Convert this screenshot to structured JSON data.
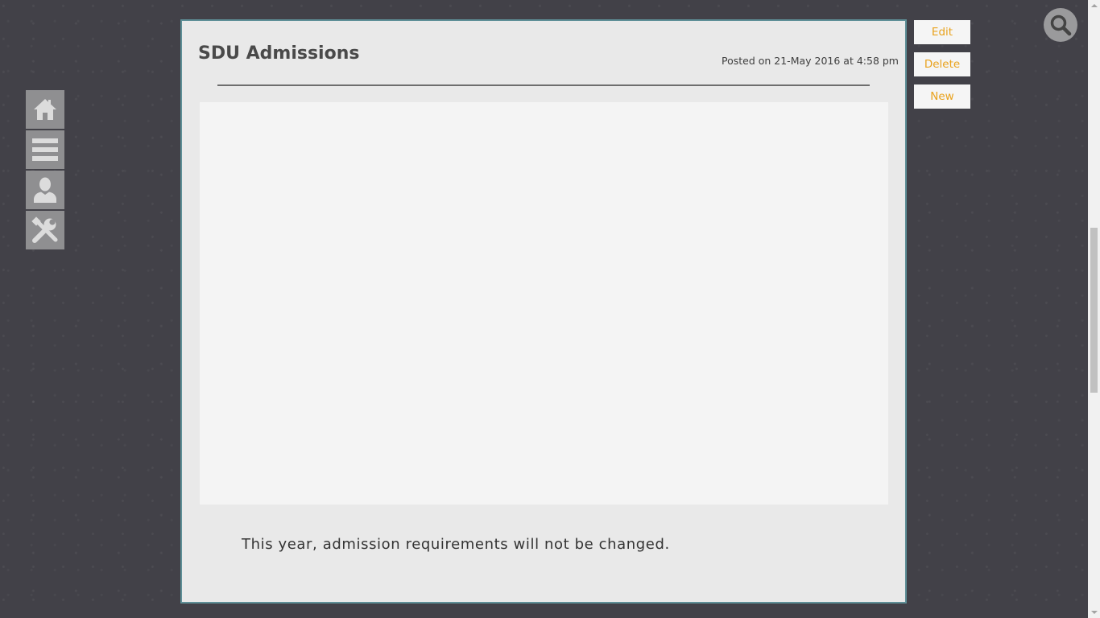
{
  "nav": {
    "items": [
      {
        "icon": "home-icon",
        "label": "Home"
      },
      {
        "icon": "menu-icon",
        "label": "Menu"
      },
      {
        "icon": "user-icon",
        "label": "Profile"
      },
      {
        "icon": "tools-icon",
        "label": "Settings"
      }
    ]
  },
  "search": {
    "icon": "search-icon"
  },
  "post": {
    "title": "SDU Admissions",
    "meta": "Posted on 21-May 2016 at 4:58 pm",
    "body": "This year, admission requirements will not be changed."
  },
  "actions": {
    "edit_label": "Edit",
    "delete_label": "Delete",
    "new_label": "New"
  },
  "colors": {
    "background": "#424148",
    "card": "#e9e9e9",
    "card_border": "#5e8f97",
    "accent": "#e9a21c",
    "nav_button": "#8f8f91"
  }
}
